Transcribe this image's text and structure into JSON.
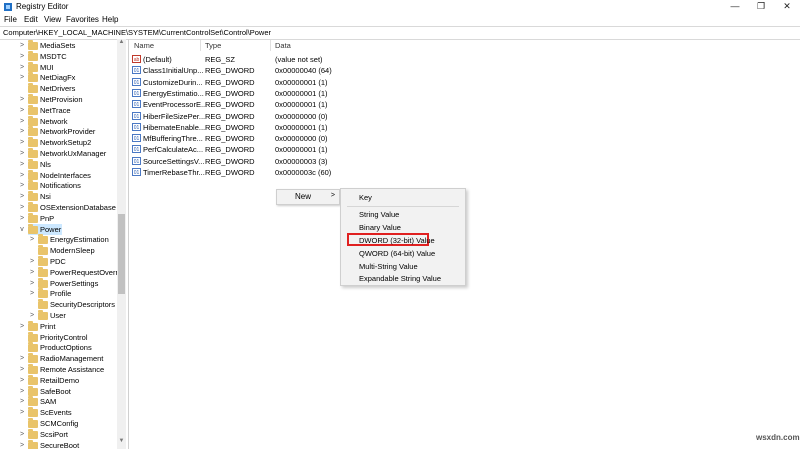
{
  "window": {
    "title": "Registry Editor"
  },
  "menu": [
    "File",
    "Edit",
    "View",
    "Favorites",
    "Help"
  ],
  "address": "Computer\\HKEY_LOCAL_MACHINE\\SYSTEM\\CurrentControlSet\\Control\\Power",
  "tree": [
    {
      "label": "MediaSets",
      "arrow": ">"
    },
    {
      "label": "MSDTC",
      "arrow": ">"
    },
    {
      "label": "MUI",
      "arrow": ">"
    },
    {
      "label": "NetDiagFx",
      "arrow": ">"
    },
    {
      "label": "NetDrivers",
      "arrow": ""
    },
    {
      "label": "NetProvision",
      "arrow": ">"
    },
    {
      "label": "NetTrace",
      "arrow": ">"
    },
    {
      "label": "Network",
      "arrow": ">"
    },
    {
      "label": "NetworkProvider",
      "arrow": ">"
    },
    {
      "label": "NetworkSetup2",
      "arrow": ">"
    },
    {
      "label": "NetworkUxManager",
      "arrow": ">"
    },
    {
      "label": "Nls",
      "arrow": ">"
    },
    {
      "label": "NodeInterfaces",
      "arrow": ">"
    },
    {
      "label": "Notifications",
      "arrow": ">"
    },
    {
      "label": "Nsi",
      "arrow": ">"
    },
    {
      "label": "OSExtensionDatabase",
      "arrow": ">"
    },
    {
      "label": "PnP",
      "arrow": ">"
    },
    {
      "label": "Power",
      "arrow": "v",
      "selected": true
    },
    {
      "label": "EnergyEstimation",
      "arrow": ">",
      "child": true
    },
    {
      "label": "ModernSleep",
      "arrow": "",
      "child": true
    },
    {
      "label": "PDC",
      "arrow": ">",
      "child": true
    },
    {
      "label": "PowerRequestOverrid",
      "arrow": ">",
      "child": true
    },
    {
      "label": "PowerSettings",
      "arrow": ">",
      "child": true
    },
    {
      "label": "Profile",
      "arrow": ">",
      "child": true
    },
    {
      "label": "SecurityDescriptors",
      "arrow": "",
      "child": true
    },
    {
      "label": "User",
      "arrow": ">",
      "child": true
    },
    {
      "label": "Print",
      "arrow": ">"
    },
    {
      "label": "PriorityControl",
      "arrow": ""
    },
    {
      "label": "ProductOptions",
      "arrow": ""
    },
    {
      "label": "RadioManagement",
      "arrow": ">"
    },
    {
      "label": "Remote Assistance",
      "arrow": ">"
    },
    {
      "label": "RetailDemo",
      "arrow": ">"
    },
    {
      "label": "SafeBoot",
      "arrow": ">"
    },
    {
      "label": "SAM",
      "arrow": ">"
    },
    {
      "label": "ScEvents",
      "arrow": ">"
    },
    {
      "label": "SCMConfig",
      "arrow": ""
    },
    {
      "label": "ScsiPort",
      "arrow": ">"
    },
    {
      "label": "SecureBoot",
      "arrow": ">"
    }
  ],
  "columns": {
    "name": "Name",
    "type": "Type",
    "data": "Data"
  },
  "values": [
    {
      "icon": "ab",
      "name": "(Default)",
      "type": "REG_SZ",
      "data": "(value not set)"
    },
    {
      "icon": "01",
      "name": "Class1InitialUnp...",
      "type": "REG_DWORD",
      "data": "0x00000040 (64)"
    },
    {
      "icon": "01",
      "name": "CustomizeDurin...",
      "type": "REG_DWORD",
      "data": "0x00000001 (1)"
    },
    {
      "icon": "01",
      "name": "EnergyEstimatio...",
      "type": "REG_DWORD",
      "data": "0x00000001 (1)"
    },
    {
      "icon": "01",
      "name": "EventProcessorE...",
      "type": "REG_DWORD",
      "data": "0x00000001 (1)"
    },
    {
      "icon": "01",
      "name": "HiberFileSizePer...",
      "type": "REG_DWORD",
      "data": "0x00000000 (0)"
    },
    {
      "icon": "01",
      "name": "HibernateEnable...",
      "type": "REG_DWORD",
      "data": "0x00000001 (1)"
    },
    {
      "icon": "01",
      "name": "MfBufferingThre...",
      "type": "REG_DWORD",
      "data": "0x00000000 (0)"
    },
    {
      "icon": "01",
      "name": "PerfCalculateAc...",
      "type": "REG_DWORD",
      "data": "0x00000001 (1)"
    },
    {
      "icon": "01",
      "name": "SourceSettingsV...",
      "type": "REG_DWORD",
      "data": "0x00000003 (3)"
    },
    {
      "icon": "01",
      "name": "TimerRebaseThr...",
      "type": "REG_DWORD",
      "data": "0x0000003c (60)"
    }
  ],
  "context_menu": {
    "new_label": "New",
    "arrow": ">"
  },
  "submenu": {
    "key": "Key",
    "string": "String Value",
    "binary": "Binary Value",
    "dword": "DWORD (32-bit) Value",
    "qword": "QWORD (64-bit) Value",
    "multi": "Multi-String Value",
    "expandable": "Expandable String Value"
  },
  "watermark": "wsxdn.com",
  "colors": {
    "highlight": "#e02020",
    "selection": "#cce8ff",
    "folder": "#e9c46a"
  }
}
